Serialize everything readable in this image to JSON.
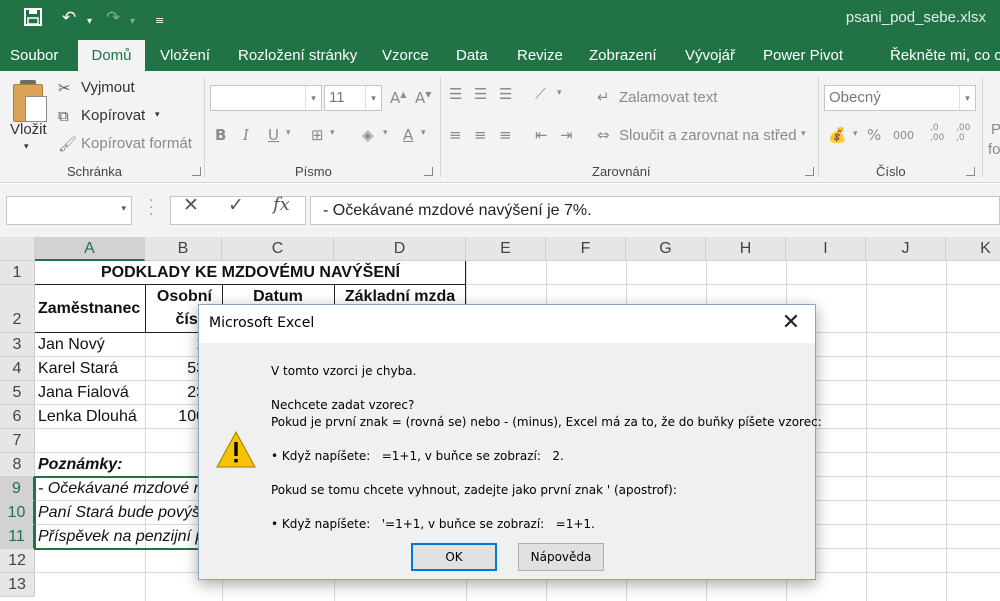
{
  "app": {
    "file_title": "psani_pod_sebe.xlsx"
  },
  "tabs": [
    "Soubor",
    "Domů",
    "Vložení",
    "Rozložení stránky",
    "Vzorce",
    "Data",
    "Revize",
    "Zobrazení",
    "Vývojář",
    "Power Pivot",
    "Řekněte mi, co c"
  ],
  "ribbon": {
    "paste_label": "Vložit",
    "cut_label": "Vyjmout",
    "copy_label": "Kopírovat",
    "format_painter_label": "Kopírovat formát",
    "clipboard_group": "Schránka",
    "font_size": "11",
    "font_group": "Písmo",
    "wrap_text_label": "Zalamovat text",
    "merge_center_label": "Sloučit a zarovnat na střed",
    "alignment_group": "Zarovnání",
    "number_format": "Obecný",
    "number_group": "Číslo",
    "bold": "B",
    "italic": "I",
    "underline": "U",
    "percent": "%",
    "thousands": "000",
    "dec_increase": ",0\n,00",
    "dec_decrease": ",00\n,0",
    "styles_clip_1": "P",
    "styles_clip_2": "fo"
  },
  "formula_bar": {
    "name_box": "",
    "formula": "- Očekávané mzdové navýšení je 7%.",
    "cancel": "✕",
    "enter": "✓",
    "fx": "fx"
  },
  "columns": [
    "A",
    "B",
    "C",
    "D",
    "E",
    "F",
    "G",
    "H",
    "I",
    "J",
    "K"
  ],
  "rows": [
    "1",
    "2",
    "3",
    "4",
    "5",
    "6",
    "7",
    "8",
    "9",
    "10",
    "11",
    "12",
    "13"
  ],
  "sheet": {
    "title": "PODKLADY KE MZDOVÉMU NAVÝŠENÍ",
    "h_employee": "Zaměstnanec",
    "h_personal_1": "Osobní",
    "h_personal_2": "číslo",
    "h_date": "Datum",
    "h_salary": "Základní mzda",
    "employees": [
      {
        "name": "Jan Nový",
        "number": "1"
      },
      {
        "name": "Karel Stará",
        "number": "53"
      },
      {
        "name": "Jana Fialová",
        "number": "23"
      },
      {
        "name": "Lenka Dlouhá",
        "number": "100"
      }
    ],
    "notes_label": "Poznámky:",
    "note_1": "- Očekávané mzdové n",
    "note_2": "Paní Stará bude povýše",
    "note_3": "Příspěvek na penzijní p"
  },
  "dialog": {
    "title": "Microsoft Excel",
    "close": "✕",
    "line_1": "V tomto vzorci je chyba.",
    "line_2": "Nechcete zadat vzorec?",
    "line_3": "Pokud je první znak = (rovná se) nebo - (minus), Excel má za to, že do buňky píšete vzorec:",
    "line_4": "• Když napíšete:   =1+1, v buňce se zobrazí:   2.",
    "line_5": "Pokud se tomu chcete vyhnout, zadejte jako první znak ' (apostrof):",
    "line_6": "• Když napíšete:   '=1+1, v buňce se zobrazí:   =1+1.",
    "ok_label": "OK",
    "help_label": "Nápověda"
  },
  "colors": {
    "accent": "#217346",
    "warning": "#f5c300"
  }
}
